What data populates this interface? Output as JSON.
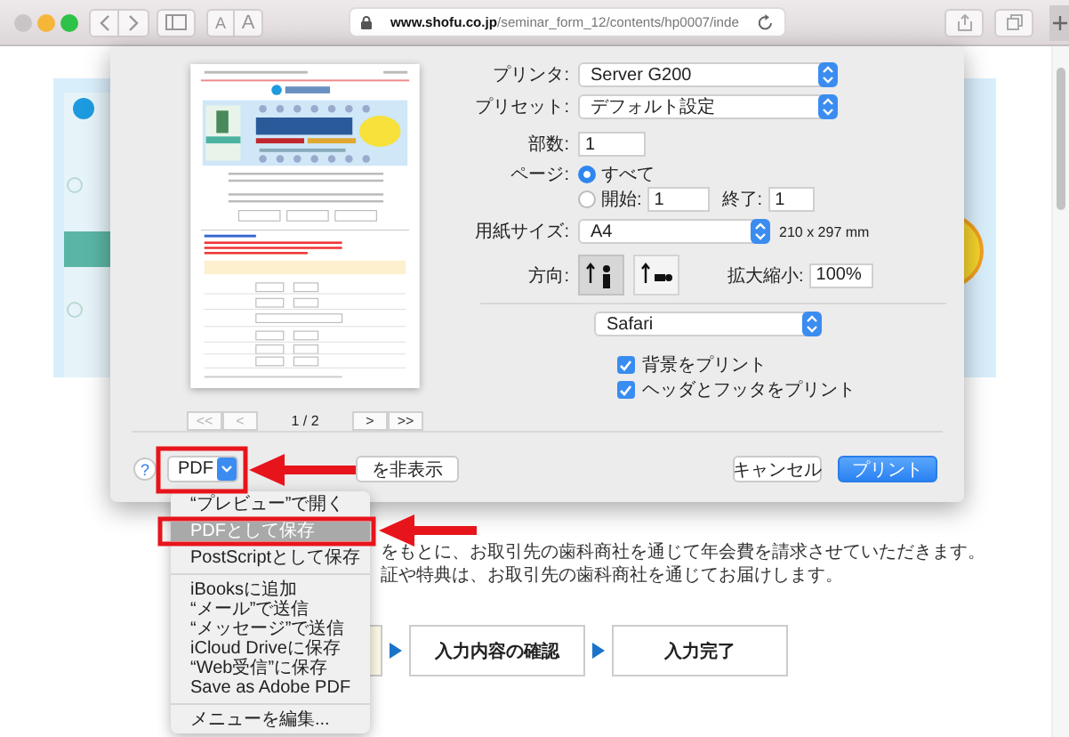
{
  "browser": {
    "url": "**www.shofu.co.jp**/seminar_form_12/contents/hp0007/inde",
    "font_buttons": [
      "A",
      "A"
    ]
  },
  "page": {
    "lines": [
      "をもとに、お取引先の歯科商社を通じて年会費を請求させていただきます。",
      "証や特典は、お取引先の歯科商社を通じてお届けします。"
    ],
    "steps": [
      {
        "label": "入力内容の確認"
      },
      {
        "label": "入力完了"
      }
    ]
  },
  "print_dialog": {
    "preview": {
      "page_indicator": "1 / 2",
      "nav": [
        {
          "label": "<<",
          "disabled": true
        },
        {
          "label": "<",
          "disabled": true
        },
        {
          "label": ">",
          "disabled": false
        },
        {
          "label": ">>",
          "disabled": false
        }
      ]
    },
    "printer": {
      "label": "プリンタ:",
      "value": "Server G200"
    },
    "preset": {
      "label": "プリセット:",
      "value": "デフォルト設定"
    },
    "copies": {
      "label": "部数:",
      "value": "1"
    },
    "pages": {
      "label": "ページ:",
      "options": [
        {
          "label": "すべて",
          "selected": true
        },
        {
          "label": "開始:",
          "selected": false
        }
      ],
      "from": "1",
      "to_label": "終了:",
      "to": "1"
    },
    "paper_size": {
      "label": "用紙サイズ:",
      "value": "A4",
      "dimensions": "210 x 297 mm"
    },
    "orientation": {
      "label": "方向:",
      "options": [
        {
          "kind": "portrait",
          "selected": true
        },
        {
          "kind": "landscape",
          "selected": false
        }
      ]
    },
    "scale": {
      "label": "拡大縮小:",
      "value": "100%"
    },
    "section": "Safari",
    "options": [
      {
        "label": "背景をプリント",
        "checked": true
      },
      {
        "label": "ヘッダとフッタをプリント",
        "checked": true
      }
    ],
    "help": "?",
    "pdf_button": "PDF",
    "details_button": "を非表示",
    "cancel": "キャンセル",
    "print": "プリント"
  },
  "pdf_menu": {
    "items": [
      {
        "kind": "item",
        "label": "“プレビュー”で開く",
        "selected": false
      },
      {
        "kind": "item",
        "label": "PDFとして保存",
        "selected": true
      },
      {
        "kind": "item",
        "label": "PostScriptとして保存",
        "selected": false
      },
      {
        "kind": "separator"
      },
      {
        "kind": "item",
        "label": "iBooksに追加",
        "selected": false
      },
      {
        "kind": "item",
        "label": "“メール”で送信",
        "selected": false
      },
      {
        "kind": "item",
        "label": "“メッセージ”で送信",
        "selected": false
      },
      {
        "kind": "item",
        "label": "iCloud Driveに保存",
        "selected": false
      },
      {
        "kind": "item",
        "label": "“Web受信”に保存",
        "selected": false
      },
      {
        "kind": "item",
        "label": "Save as Adobe PDF",
        "selected": false
      },
      {
        "kind": "separator"
      },
      {
        "kind": "item",
        "label": "メニューを編集...",
        "selected": false
      }
    ]
  }
}
